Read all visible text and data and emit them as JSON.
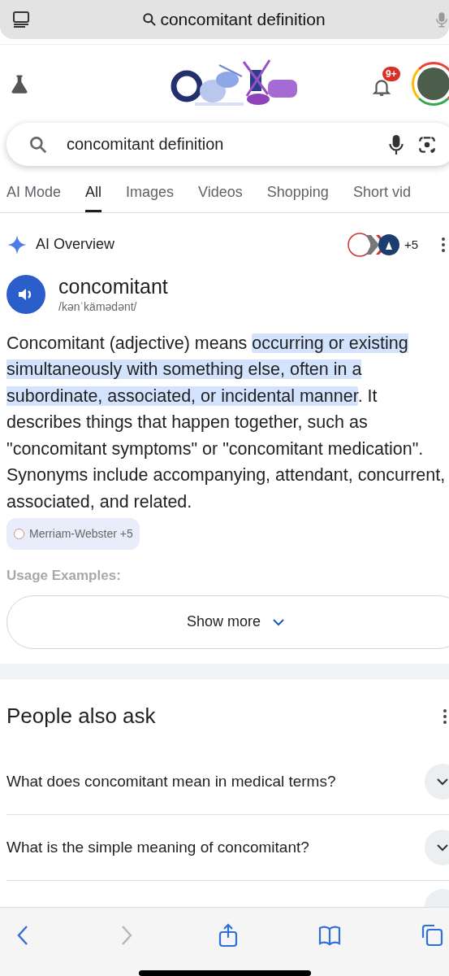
{
  "browser_bar": {
    "url_text": "concomitant definition"
  },
  "header": {
    "notification_badge": "9+"
  },
  "search": {
    "value": "concomitant definition"
  },
  "tabs": [
    {
      "label": "AI Mode",
      "selected": false
    },
    {
      "label": "All",
      "selected": true
    },
    {
      "label": "Images",
      "selected": false
    },
    {
      "label": "Videos",
      "selected": false
    },
    {
      "label": "Shopping",
      "selected": false
    },
    {
      "label": "Short vid",
      "selected": false
    }
  ],
  "ai_overview": {
    "title": "AI Overview",
    "sources_more": "+5",
    "word": "concomitant",
    "pronunciation": "/kənˈkämədənt/",
    "definition": [
      {
        "text": "Concomitant (adjective) means ",
        "highlighted": false
      },
      {
        "text": "occurring or existing simultaneously with something else, often in a subordinate, associated, or incidental manner",
        "highlighted": true
      },
      {
        "text": ". It describes things that happen together, such as \"concomitant symptoms\" or \"concomitant medication\". Synonyms include accompanying, attendant, concurrent, associated, and related.",
        "highlighted": false
      }
    ],
    "citation": "Merriam-Webster +5",
    "faded_heading": "Usage Examples:",
    "show_more": "Show more"
  },
  "people_also_ask": {
    "title": "People also ask",
    "questions": [
      "What does concomitant mean in medical terms?",
      "What is the simple meaning of concomitant?"
    ]
  },
  "toolbar": [
    {
      "kind": "back",
      "disabled": false
    },
    {
      "kind": "forward",
      "disabled": true
    },
    {
      "kind": "share",
      "disabled": false
    },
    {
      "kind": "bookmarks",
      "disabled": false
    },
    {
      "kind": "tabs",
      "disabled": false
    }
  ]
}
